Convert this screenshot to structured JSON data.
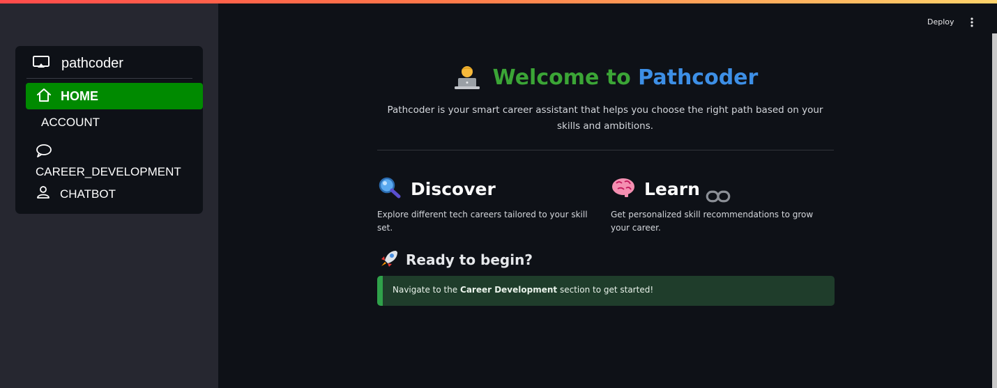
{
  "sidebar": {
    "brand": {
      "name": "pathcoder",
      "icon": "cast-icon"
    },
    "items": [
      {
        "label": "HOME",
        "icon": "home-icon",
        "active": true
      },
      {
        "label": "ACCOUNT",
        "icon": null,
        "active": false
      },
      {
        "label": "CAREER_DEVELOPMENT",
        "icon": "chat-bubble-icon",
        "active": false
      },
      {
        "label": "CHATBOT",
        "icon": "user-icon",
        "active": false
      }
    ],
    "active_color": "#008a00"
  },
  "topbar": {
    "deploy_label": "Deploy",
    "menu_icon": "vertical-dots-icon"
  },
  "hero": {
    "emoji": "technologist-emoji",
    "title_part1": "Welcome to",
    "title_part2": "Pathcoder",
    "title_colors": {
      "part1": "#3ba536",
      "part2": "#3d8fe6"
    },
    "intro": "Pathcoder is your smart career assistant that helps you choose the right path based on your skills and ambitions."
  },
  "features": [
    {
      "emoji": "magnifier-emoji",
      "title": "Discover",
      "desc": "Explore different tech careers tailored to your skill set."
    },
    {
      "emoji": "brain-emoji",
      "title": "Learn",
      "desc": "Get personalized skill recommendations to grow your career.",
      "link_icon": "link-icon"
    }
  ],
  "ready": {
    "emoji": "rocket-emoji",
    "title": "Ready to begin?"
  },
  "alert": {
    "prefix": "Navigate to the ",
    "bold": "Career Development",
    "suffix": " section to get started!",
    "color": "#2fa14a"
  }
}
